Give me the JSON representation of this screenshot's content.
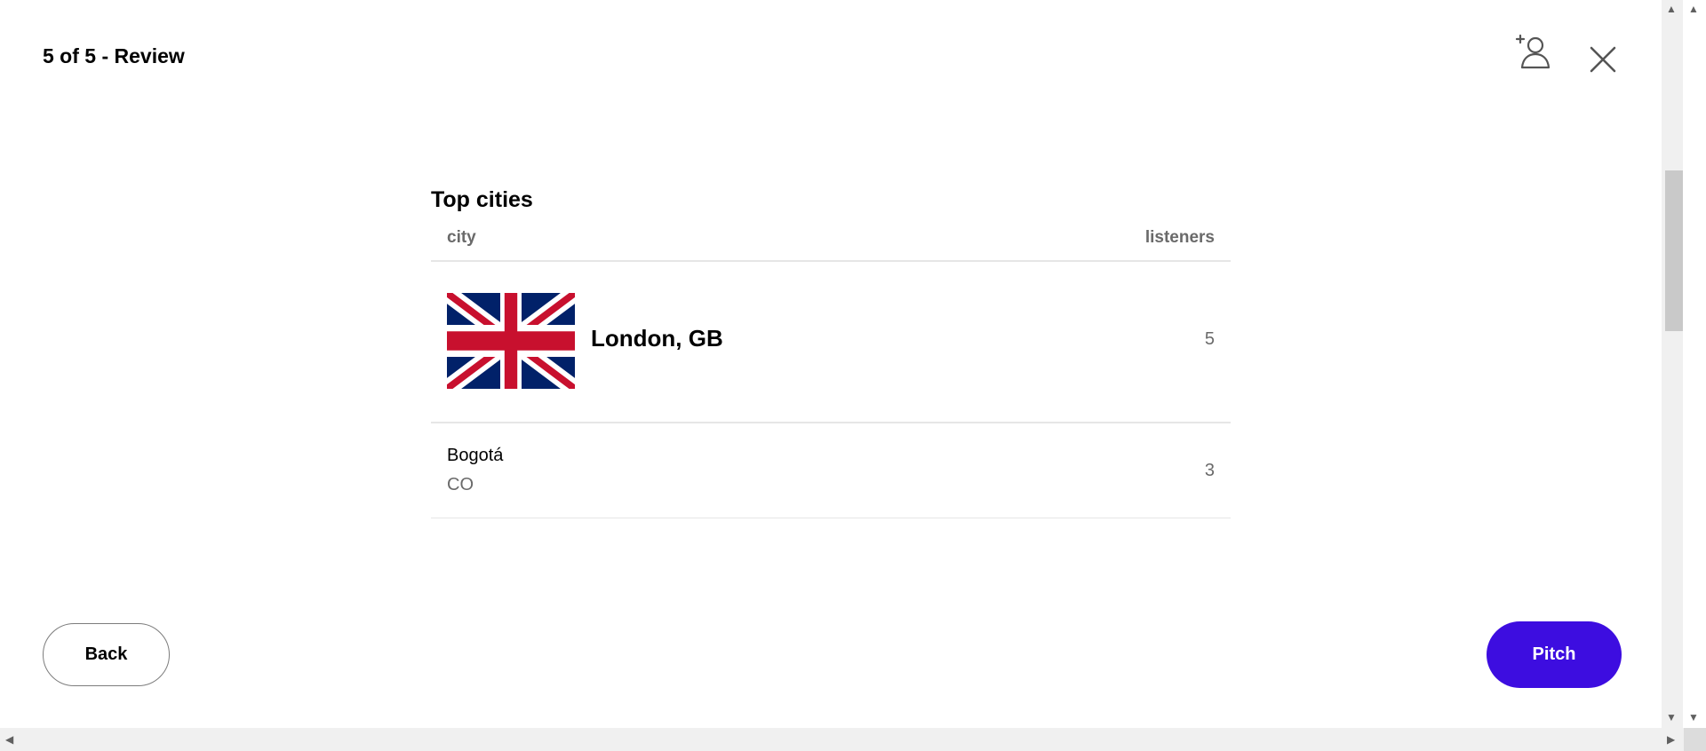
{
  "header": {
    "step_title": "5 of 5 - Review",
    "icons": [
      "add-collaborator-icon",
      "close-icon"
    ]
  },
  "section": {
    "title": "Top cities",
    "columns": {
      "city": "city",
      "listeners": "listeners"
    }
  },
  "top_city": {
    "name": "London, GB",
    "listeners": "5",
    "flag": "united-kingdom-flag"
  },
  "rows": [
    {
      "city": "Bogotá",
      "country": "CO",
      "listeners": "3"
    }
  ],
  "footer": {
    "back_label": "Back",
    "pitch_label": "Pitch"
  },
  "colors": {
    "accent": "#3d0de0",
    "muted_text": "#6a6a6a",
    "divider": "#e6e6e6"
  }
}
